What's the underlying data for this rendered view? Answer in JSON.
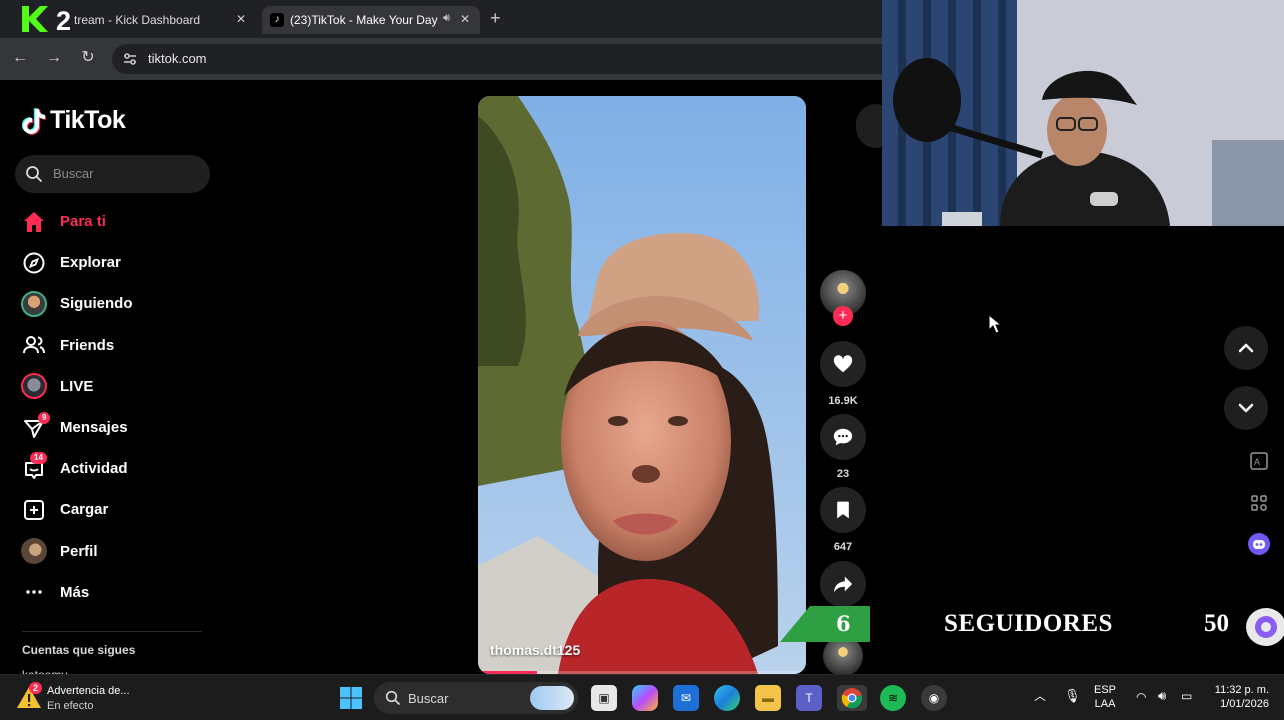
{
  "browser": {
    "tabs": [
      {
        "title": "tream - Kick Dashboard",
        "close": "✕"
      },
      {
        "title": "(23)TikTok - Make Your Day",
        "close": "✕"
      }
    ],
    "new_tab": "+",
    "url": "tiktok.com"
  },
  "kick_logo": "K2",
  "tiktok": {
    "brand": "TikTok",
    "search_placeholder": "Buscar",
    "nav": [
      {
        "label": "Para ti",
        "icon": "home-icon"
      },
      {
        "label": "Explorar",
        "icon": "compass-icon"
      },
      {
        "label": "Siguiendo",
        "icon": "following-avatar-icon"
      },
      {
        "label": "Friends",
        "icon": "friends-icon"
      },
      {
        "label": "LIVE",
        "icon": "live-avatar-icon"
      },
      {
        "label": "Mensajes",
        "icon": "send-icon",
        "badge": "9"
      },
      {
        "label": "Actividad",
        "icon": "inbox-icon",
        "badge": "14"
      },
      {
        "label": "Cargar",
        "icon": "upload-icon"
      },
      {
        "label": "Perfil",
        "icon": "profile-avatar-icon"
      },
      {
        "label": "Más",
        "icon": "more-icon"
      }
    ],
    "following_title": "Cuentas que sigues",
    "following_peek": "katoomy"
  },
  "video": {
    "author": "thomas.dt125",
    "progress": 0.18
  },
  "actions": {
    "likes": "16.9K",
    "comments": "23",
    "saves": "647"
  },
  "overlay": {
    "count": "6",
    "label": "SEGUIDORES",
    "goal": "50"
  },
  "taskbar": {
    "weather_badge": "2",
    "weather_title": "Advertencia de...",
    "weather_sub": "En efecto",
    "search": "Buscar",
    "lang_top": "ESP",
    "lang_bottom": "LAA",
    "time": "11:32 p. m.",
    "date": "1/01/2026"
  },
  "colors": {
    "accent": "#fe2c55",
    "chrome_dark": "#202124",
    "chrome_tab": "#35363a",
    "overlay_green": "#2ea043"
  }
}
